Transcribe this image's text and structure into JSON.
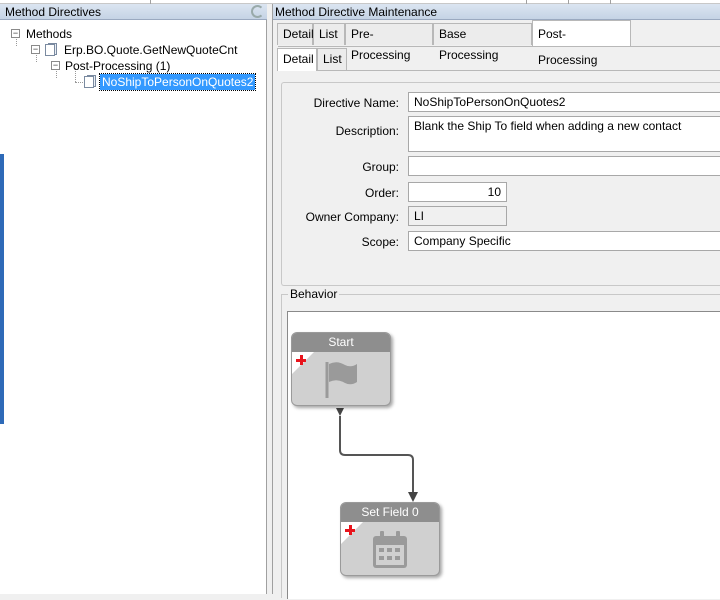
{
  "left_panel": {
    "title": "Method Directives",
    "tree": {
      "root": "Methods",
      "method": "Erp.BO.Quote.GetNewQuoteCnt",
      "group": "Post-Processing (1)",
      "directive": "NoShipToPersonOnQuotes2"
    }
  },
  "right_panel": {
    "title": "Method Directive Maintenance",
    "tabs": [
      "Detail",
      "List",
      "Pre-Processing",
      "Base Processing",
      "Post-Processing"
    ],
    "subtabs": [
      "Detail",
      "List"
    ],
    "form": {
      "directive_name_label": "Directive Name:",
      "directive_name": "NoShipToPersonOnQuotes2",
      "description_label": "Description:",
      "description": "Blank the Ship To field when adding a new contact",
      "group_label": "Group:",
      "group": "",
      "order_label": "Order:",
      "order": "10",
      "owner_company_label": "Owner Company:",
      "owner_company": "LI",
      "scope_label": "Scope:",
      "scope": "Company Specific"
    },
    "behavior": {
      "label": "Behavior",
      "nodes": [
        {
          "title": "Start",
          "icon": "flag-icon"
        },
        {
          "title": "Set Field 0",
          "icon": "calendar-icon"
        }
      ]
    }
  },
  "colors": {
    "title_bar": "#c5d3e5",
    "selection": "#3399ff",
    "node_header": "#8e8e8e",
    "node_body": "#d0d0d0",
    "plus": "#e8141c"
  }
}
